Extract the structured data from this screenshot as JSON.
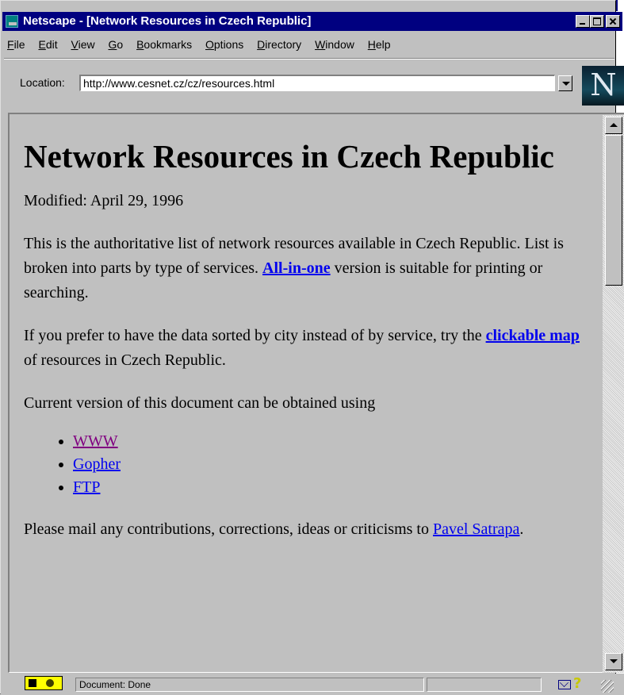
{
  "window": {
    "title": "Netscape - [Network Resources in Czech Republic]"
  },
  "menu": {
    "items": [
      {
        "mnemonic": "F",
        "rest": "ile"
      },
      {
        "mnemonic": "E",
        "rest": "dit"
      },
      {
        "mnemonic": "V",
        "rest": "iew"
      },
      {
        "mnemonic": "G",
        "rest": "o"
      },
      {
        "mnemonic": "B",
        "rest": "ookmarks"
      },
      {
        "mnemonic": "O",
        "rest": "ptions"
      },
      {
        "mnemonic": "D",
        "rest": "irectory"
      },
      {
        "mnemonic": "W",
        "rest": "indow"
      },
      {
        "mnemonic": "H",
        "rest": "elp"
      }
    ]
  },
  "location": {
    "label": "Location:",
    "url": "http://www.cesnet.cz/cz/resources.html"
  },
  "logo": {
    "letter": "N"
  },
  "page": {
    "heading": "Network Resources in Czech Republic",
    "modified": "Modified: April 29, 1996",
    "intro_part1": "This is the authoritative list of network resources available in Czech Republic. List is broken into parts by type of services.",
    "all_in_one_link": "All-in-one",
    "intro_part2": "version is suitable for printing or searching.",
    "prefer_part1": "If you prefer to have the data sorted by city instead of by service, try the",
    "clickable_map_link": "clickable map",
    "prefer_part2": "of resources in Czech Republic.",
    "obtain_text": "Current version of this document can be obtained using",
    "obtain_links": [
      "WWW",
      "Gopher",
      "FTP"
    ],
    "mail_part1": "Please mail any contributions, corrections, ideas or criticisms to",
    "mail_link": "Pavel Satrapa",
    "mail_part2": "."
  },
  "status": {
    "text": "Document: Done"
  },
  "colors": {
    "titlebar": "#000080",
    "link": "#0000ee",
    "visited_link": "#800080",
    "background": "#c0c0c0"
  }
}
